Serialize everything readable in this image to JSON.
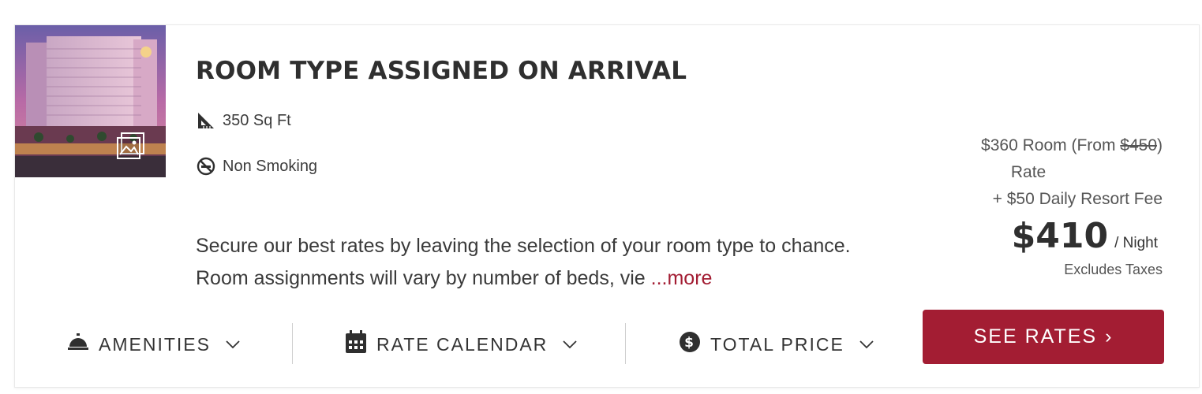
{
  "room": {
    "title": "ROOM TYPE ASSIGNED ON ARRIVAL",
    "features": {
      "size": "350 Sq Ft",
      "smoking": "Non Smoking"
    },
    "description": "Secure our best rates by leaving the selection of your room type to chance. Room assignments will vary by number of beds, vie ",
    "more_label": "...more"
  },
  "pricing": {
    "room_rate_prefix": "$360 Room (From ",
    "original_price": "$450",
    "room_rate_suffix": ")",
    "rate_word": "Rate",
    "resort_fee": "+ $50 Daily Resort Fee",
    "total": "$410",
    "per_night": "/ Night",
    "excludes": "Excludes Taxes"
  },
  "tabs": {
    "amenities": "AMENITIES",
    "rate_calendar": "RATE CALENDAR",
    "total_price": "TOTAL PRICE"
  },
  "cta": {
    "see_rates": "SEE RATES",
    "arrow": "›"
  },
  "colors": {
    "accent": "#a31d33",
    "text": "#333333"
  },
  "icons": [
    "ruler-icon",
    "no-smoking-icon",
    "gallery-icon",
    "service-bell-icon",
    "calendar-icon",
    "dollar-circle-icon",
    "chevron-down-icon"
  ]
}
